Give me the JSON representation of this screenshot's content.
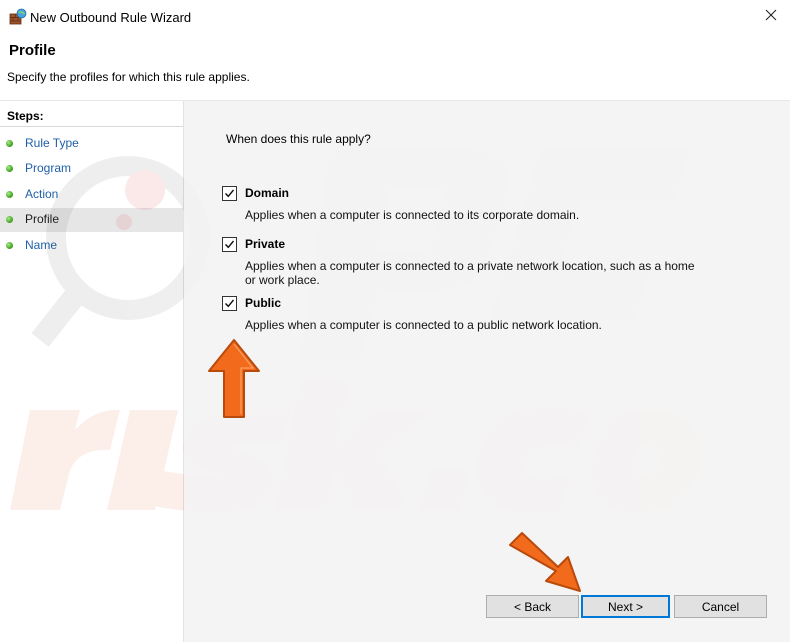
{
  "window": {
    "title": "New Outbound Rule Wizard",
    "icon": "firewall-rule-icon",
    "close_icon": "close-icon"
  },
  "header": {
    "title": "Profile",
    "subtitle": "Specify the profiles for which this rule applies."
  },
  "steps": {
    "label": "Steps:",
    "items": [
      {
        "label": "Rule Type",
        "active": false
      },
      {
        "label": "Program",
        "active": false
      },
      {
        "label": "Action",
        "active": false
      },
      {
        "label": "Profile",
        "active": true
      },
      {
        "label": "Name",
        "active": false
      }
    ]
  },
  "content": {
    "question": "When does this rule apply?",
    "options": [
      {
        "label": "Domain",
        "checked": true,
        "description": "Applies when a computer is connected to its corporate domain."
      },
      {
        "label": "Private",
        "checked": true,
        "description": "Applies when a computer is connected to a private network location, such as a home or work place."
      },
      {
        "label": "Public",
        "checked": true,
        "description": "Applies when a computer is connected to a public network location."
      }
    ]
  },
  "buttons": {
    "back": "< Back",
    "next": "Next >",
    "cancel": "Cancel"
  },
  "colors": {
    "accent_arrow": "#f26b1d",
    "link": "#1f5fa8",
    "content_bg": "#f3f3f3"
  }
}
